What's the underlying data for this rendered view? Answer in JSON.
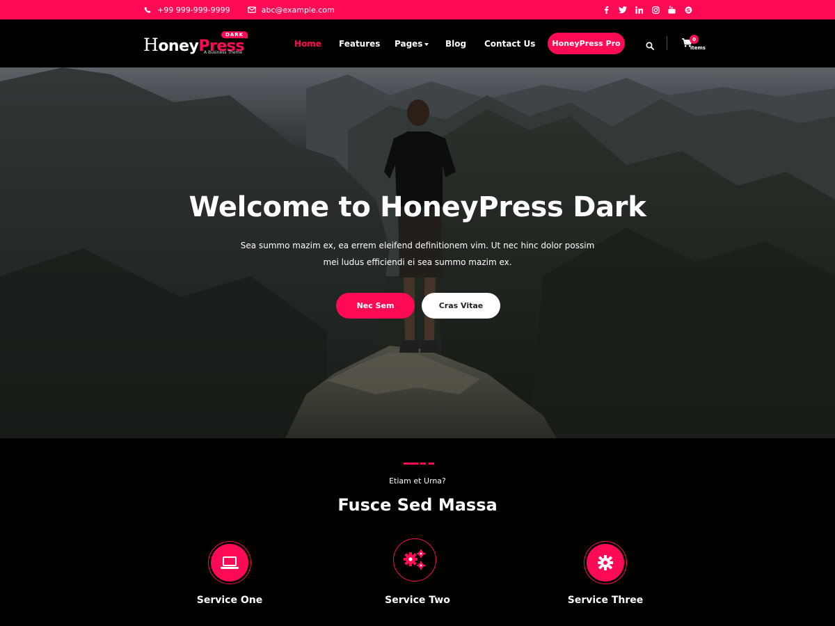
{
  "topbar": {
    "phone": "+99 999-999-9999",
    "email": "abc@example.com",
    "social_icons": [
      "facebook-icon",
      "twitter-icon",
      "linkedin-icon",
      "instagram-icon",
      "youtube-icon",
      "skype-icon"
    ]
  },
  "logo": {
    "text_h": "H",
    "text_oney": "oney",
    "text_press": "Press",
    "badge": "DARK",
    "tagline": "A Business Theme"
  },
  "nav": {
    "items": [
      {
        "label": "Home",
        "active": true
      },
      {
        "label": "Features"
      },
      {
        "label": "Pages",
        "dropdown": true
      },
      {
        "label": "Blog"
      },
      {
        "label": "Contact Us"
      }
    ],
    "cta": "HoneyPress Pro",
    "cart_count": "0",
    "cart_label": "items"
  },
  "hero": {
    "title": "Welcome to HoneyPress Dark",
    "line1": "Sea summo mazim ex, ea errem eleifend definitionem vim. Ut nec hinc dolor possim",
    "line2": "mei ludus efficiendi ei sea summo mazim ex.",
    "primary_button": "Nec Sem",
    "secondary_button": "Cras Vitae"
  },
  "services": {
    "kicker": "Etiam et Urna?",
    "title": "Fusce Sed Massa",
    "items": [
      {
        "label": "Service One",
        "icon": "laptop-icon"
      },
      {
        "label": "Service Two",
        "icon": "cogs-icon"
      },
      {
        "label": "Service Three",
        "icon": "gear-icon"
      }
    ]
  },
  "colors": {
    "accent": "#ff0a54",
    "background": "#000000",
    "text": "#ffffff"
  }
}
